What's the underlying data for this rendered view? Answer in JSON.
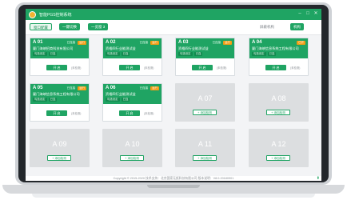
{
  "window": {
    "title": "智能PGS控制系统",
    "controls": [
      "minimize-icon",
      "maximize-icon",
      "close-icon"
    ]
  },
  "toolbar": {
    "station_button": "窗口配置",
    "onekey_button": "一键切换",
    "view_button": "一览窗 3",
    "filter_text": "屏蔽机构",
    "filter_button": "机构"
  },
  "stations": [
    {
      "name": "A 01",
      "state": "active",
      "org": "厦门海峡招商科技有限公司",
      "status": "已连接",
      "tag": "运行",
      "badges": [
        "勾选设定",
        "已连"
      ],
      "button": "开 启",
      "note": "(未检测)"
    },
    {
      "name": "A 02",
      "state": "active",
      "org": "资格四行业能测试益",
      "status": "已连接",
      "tag": "运行",
      "badges": [
        "勾选设定",
        "已连"
      ],
      "button": "开 启",
      "note": "(未检测)"
    },
    {
      "name": "A 03",
      "state": "active",
      "org": "资格四行业能测试益",
      "status": "已连接",
      "tag": "运行",
      "badges": [
        "勾选设定",
        "已连"
      ],
      "button": "开 启",
      "note": "(未检测)"
    },
    {
      "name": "A 04",
      "state": "active",
      "org": "厦门海峡信息系统工程有限公司",
      "status": "",
      "tag": "已开",
      "badges": [
        "勾选设定",
        "已连"
      ],
      "button": "开 启",
      "note": "(未检测)"
    },
    {
      "name": "A 05",
      "state": "active",
      "org": "厦门海峡信息系统工程有限公司",
      "status": "已连接",
      "tag": "运行",
      "badges": [
        "勾选设定",
        "已连"
      ],
      "button": "开 启",
      "note": "(未检测)"
    },
    {
      "name": "A 06",
      "state": "active",
      "org": "资格四行业能测试益",
      "status": "已连接",
      "tag": "运行",
      "badges": [
        "勾选设定",
        "已连"
      ],
      "button": "开 启",
      "note": "(未检测)"
    },
    {
      "name": "A 07",
      "state": "empty",
      "add_label": "添加检测"
    },
    {
      "name": "A 08",
      "state": "empty",
      "add_label": "添加检测"
    },
    {
      "name": "A 09",
      "state": "empty",
      "add_label": "添加检测"
    },
    {
      "name": "A 10",
      "state": "empty",
      "add_label": "添加检测"
    },
    {
      "name": "A 11",
      "state": "empty",
      "add_label": "添加检测"
    },
    {
      "name": "A 12",
      "state": "empty",
      "add_label": "添加检测"
    }
  ],
  "footer": {
    "text": "Copyright © 2015-2020  技术支持：北京国家无纸科技有限公司  版本说明：V8.0.20180901"
  },
  "colors": {
    "accent": "#1fa463",
    "empty_card": "#dcdee0",
    "tag": "#f39c12"
  }
}
